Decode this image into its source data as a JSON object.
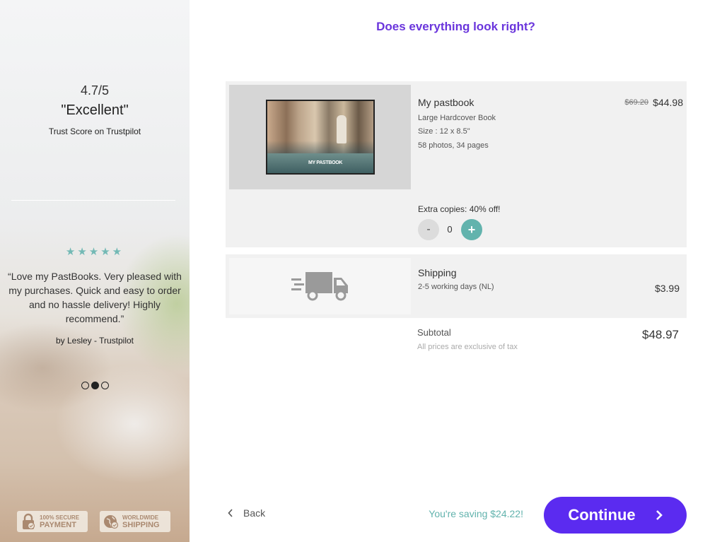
{
  "sidebar": {
    "rating_score": "4.7/5",
    "rating_word": "\"Excellent\"",
    "trust_label": "Trust Score on Trustpilot",
    "stars": "★★★★★",
    "review_text": "“Love my PastBooks. Very pleased with my purchases. Quick and easy to order and no hassle delivery! Highly recommend.”",
    "review_author": "by Lesley - Trustpilot",
    "carousel_active_index": 1,
    "badges": {
      "secure": {
        "small": "100% SECURE",
        "big": "PAYMENT",
        "icon": "lock-icon"
      },
      "shipping": {
        "small": "WORLDWIDE",
        "big": "SHIPPING",
        "icon": "globe-icon"
      }
    }
  },
  "main": {
    "heading": "Does everything look right?",
    "product": {
      "name": "My pastbook",
      "type": "Large Hardcover Book",
      "size": "Size : 12 x 8.5\"",
      "details": "58 photos, 34 pages",
      "old_price": "$69.20",
      "price": "$44.98",
      "cover_title": "MY PASTBOOK",
      "extra_label": "Extra copies: 40% off!",
      "minus_label": "-",
      "quantity": "0",
      "plus_label": "+"
    },
    "shipping": {
      "title": "Shipping",
      "subtitle": "2-5 working days (NL)",
      "price": "$3.99",
      "icon": "truck-icon"
    },
    "subtotal": {
      "label": "Subtotal",
      "note": "All prices are exclusive of tax",
      "value": "$48.97"
    },
    "footer": {
      "back_label": "Back",
      "saving_text": "You're saving $24.22!",
      "continue_label": "Continue"
    }
  },
  "colors": {
    "accent_purple": "#5b2bf0",
    "heading_purple": "#6a35dc",
    "teal": "#62b3ad"
  }
}
